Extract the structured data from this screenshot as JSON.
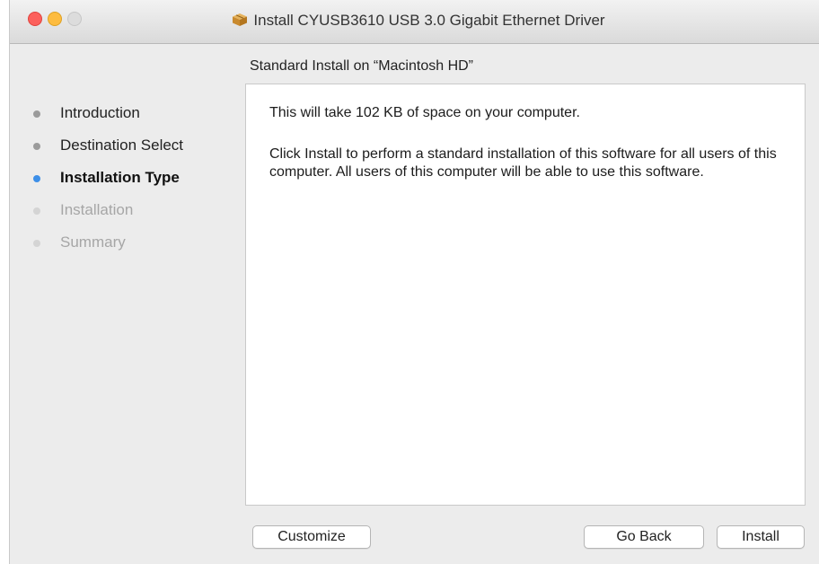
{
  "window": {
    "title": "Install CYUSB3610 USB 3.0 Gigabit Ethernet Driver",
    "title_icon": "package-icon",
    "lock_icon": "lock-icon"
  },
  "sidebar": {
    "steps": [
      {
        "label": "Introduction",
        "state": "done"
      },
      {
        "label": "Destination Select",
        "state": "done"
      },
      {
        "label": "Installation Type",
        "state": "active"
      },
      {
        "label": "Installation",
        "state": "future"
      },
      {
        "label": "Summary",
        "state": "future"
      }
    ]
  },
  "main": {
    "subtitle": "Standard Install on “Macintosh HD”",
    "paragraph1": "This will take 102 KB of space on your computer.",
    "paragraph2": "Click Install to perform a standard installation of this software for all users of this computer. All users of this computer will be able to use this software."
  },
  "buttons": {
    "customize": "Customize",
    "go_back": "Go Back",
    "install": "Install"
  },
  "colors": {
    "active_dot": "#3d8fe8",
    "close": "#fc605c",
    "minimize": "#fdbc40"
  }
}
